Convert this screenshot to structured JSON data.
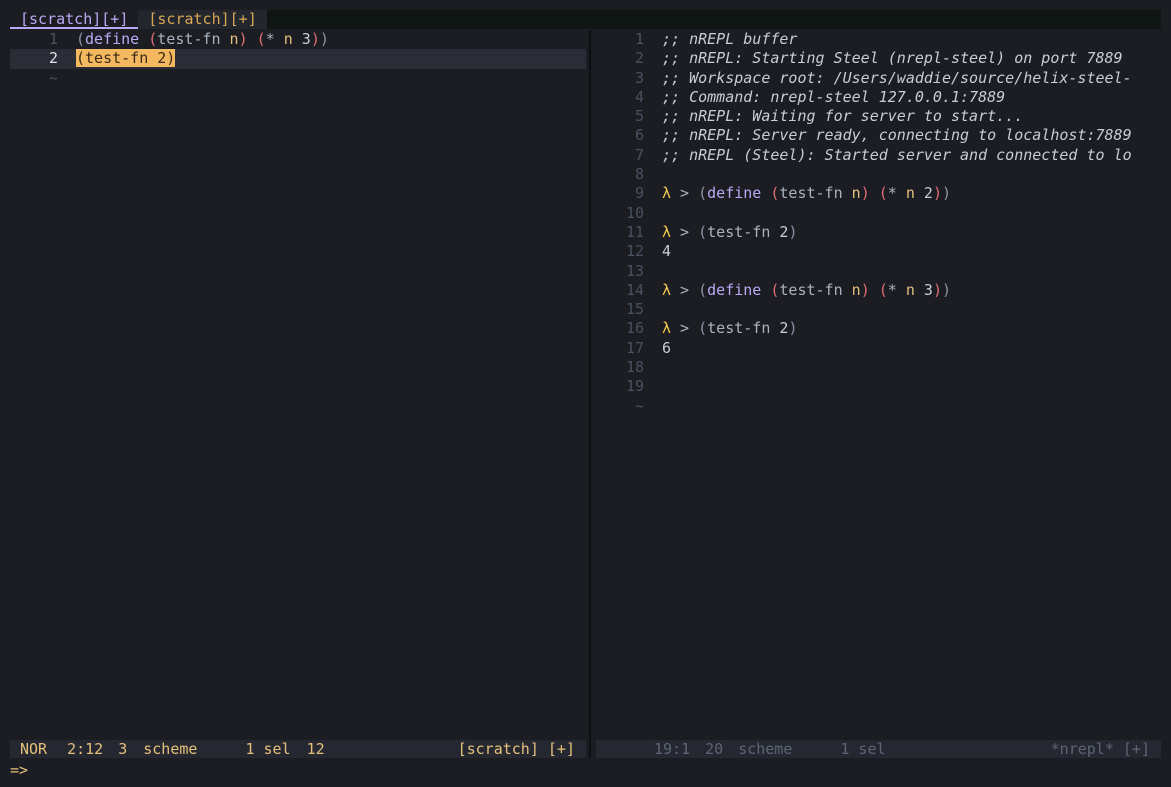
{
  "tabs": [
    {
      "label": "[scratch][+]",
      "active": true
    },
    {
      "label": "[scratch][+]",
      "active": false
    }
  ],
  "left_pane": {
    "lines": [
      {
        "num": "1",
        "tokens": [
          [
            "c-paren",
            "("
          ],
          [
            "c-kw",
            "define"
          ],
          [
            "c-fn",
            " "
          ],
          [
            "c-p2",
            "("
          ],
          [
            "c-fn",
            "test-fn "
          ],
          [
            "c-var",
            "n"
          ],
          [
            "c-p2",
            ")"
          ],
          [
            "c-fn",
            " "
          ],
          [
            "c-p2",
            "("
          ],
          [
            "c-fn",
            "* "
          ],
          [
            "c-var",
            "n"
          ],
          [
            "c-fn",
            " "
          ],
          [
            "c-num",
            "3"
          ],
          [
            "c-p2",
            ")"
          ],
          [
            "c-paren",
            ")"
          ]
        ]
      },
      {
        "num": "2",
        "cursor": true,
        "selected_text": "(test-fn 2)"
      }
    ],
    "tilde": "~"
  },
  "right_pane": {
    "lines": [
      {
        "num": "1",
        "comment": ";; nREPL buffer"
      },
      {
        "num": "2",
        "comment": ";; nREPL: Starting Steel (nrepl-steel) on port 7889"
      },
      {
        "num": "3",
        "comment": ";; Workspace root: /Users/waddie/source/helix-steel-"
      },
      {
        "num": "4",
        "comment": ";; Command: nrepl-steel 127.0.0.1:7889"
      },
      {
        "num": "5",
        "comment": ";; nREPL: Waiting for server to start..."
      },
      {
        "num": "6",
        "comment": ";; nREPL: Server ready, connecting to localhost:7889"
      },
      {
        "num": "7",
        "comment": ";; nREPL (Steel): Started server and connected to lo"
      },
      {
        "num": "8"
      },
      {
        "num": "9",
        "prompt": "λ",
        "arrow": " > ",
        "tokens": [
          [
            "c-paren",
            "("
          ],
          [
            "c-kw",
            "define"
          ],
          [
            "c-fn",
            " "
          ],
          [
            "c-p2",
            "("
          ],
          [
            "c-fn",
            "test-fn "
          ],
          [
            "c-var",
            "n"
          ],
          [
            "c-p2",
            ")"
          ],
          [
            "c-fn",
            " "
          ],
          [
            "c-p2",
            "("
          ],
          [
            "c-fn",
            "* "
          ],
          [
            "c-var",
            "n"
          ],
          [
            "c-fn",
            " "
          ],
          [
            "c-num",
            "2"
          ],
          [
            "c-p2",
            ")"
          ],
          [
            "c-paren",
            ")"
          ]
        ]
      },
      {
        "num": "10"
      },
      {
        "num": "11",
        "prompt": "λ",
        "arrow": " > ",
        "tokens": [
          [
            "c-paren",
            "("
          ],
          [
            "c-fn",
            "test-fn "
          ],
          [
            "c-num",
            "2"
          ],
          [
            "c-paren",
            ")"
          ]
        ]
      },
      {
        "num": "12",
        "output": "4"
      },
      {
        "num": "13"
      },
      {
        "num": "14",
        "prompt": "λ",
        "arrow": " > ",
        "tokens": [
          [
            "c-paren",
            "("
          ],
          [
            "c-kw",
            "define"
          ],
          [
            "c-fn",
            " "
          ],
          [
            "c-p2",
            "("
          ],
          [
            "c-fn",
            "test-fn "
          ],
          [
            "c-var",
            "n"
          ],
          [
            "c-p2",
            ")"
          ],
          [
            "c-fn",
            " "
          ],
          [
            "c-p2",
            "("
          ],
          [
            "c-fn",
            "* "
          ],
          [
            "c-var",
            "n"
          ],
          [
            "c-fn",
            " "
          ],
          [
            "c-num",
            "3"
          ],
          [
            "c-p2",
            ")"
          ],
          [
            "c-paren",
            ")"
          ]
        ]
      },
      {
        "num": "15"
      },
      {
        "num": "16",
        "prompt": "λ",
        "arrow": " > ",
        "tokens": [
          [
            "c-paren",
            "("
          ],
          [
            "c-fn",
            "test-fn "
          ],
          [
            "c-num",
            "2"
          ],
          [
            "c-paren",
            ")"
          ]
        ]
      },
      {
        "num": "17",
        "output": "6"
      },
      {
        "num": "18"
      },
      {
        "num": "19"
      }
    ],
    "tilde": "~"
  },
  "status_left": {
    "mode": "NOR",
    "position": "2:12",
    "lines": "3",
    "language": "scheme",
    "selections": "1 sel",
    "chars": "12",
    "buffer": "[scratch] [+]"
  },
  "status_right": {
    "position": "19:1",
    "lines": "20",
    "language": "scheme",
    "selections": "1 sel",
    "buffer": "*nrepl* [+]"
  },
  "command_line": "=>",
  "colors": {
    "background": "#1b1d23",
    "accent": "#b8aaf5",
    "selection": "#f4b860",
    "prompt": "#f2c94c"
  }
}
